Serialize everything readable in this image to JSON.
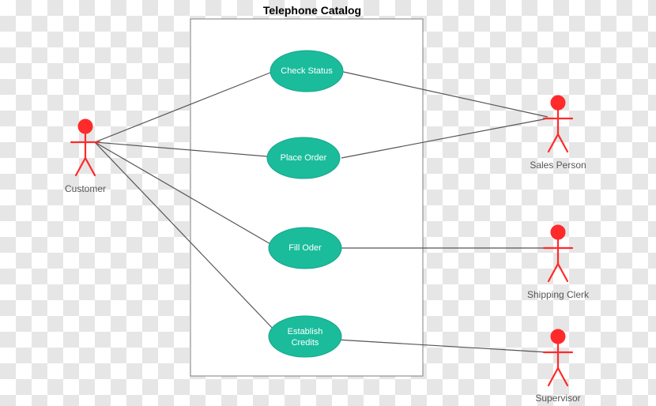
{
  "title": "Telephone Catalog",
  "actors": {
    "customer": {
      "label": "Customer"
    },
    "sales": {
      "label": "Sales Person"
    },
    "clerk": {
      "label": "Shipping Clerk"
    },
    "supervisor": {
      "label": "Supervisor"
    }
  },
  "usecases": {
    "check_status": {
      "label": "Check Status"
    },
    "place_order": {
      "label": "Place Order"
    },
    "fill_order": {
      "label": "Fill Oder"
    },
    "establish_credits": {
      "line1": "Establish",
      "line2": "Credits"
    }
  },
  "chart_data": {
    "type": "uml-use-case",
    "system": "Telephone Catalog",
    "actors": [
      "Customer",
      "Sales Person",
      "Shipping Clerk",
      "Supervisor"
    ],
    "use_cases": [
      "Check Status",
      "Place Order",
      "Fill Oder",
      "Establish Credits"
    ],
    "associations": [
      {
        "actor": "Customer",
        "use_case": "Check Status"
      },
      {
        "actor": "Customer",
        "use_case": "Place Order"
      },
      {
        "actor": "Customer",
        "use_case": "Fill Oder"
      },
      {
        "actor": "Customer",
        "use_case": "Establish Credits"
      },
      {
        "actor": "Sales Person",
        "use_case": "Check Status"
      },
      {
        "actor": "Sales Person",
        "use_case": "Place Order"
      },
      {
        "actor": "Shipping Clerk",
        "use_case": "Fill Oder"
      },
      {
        "actor": "Supervisor",
        "use_case": "Establish Credits"
      }
    ]
  }
}
